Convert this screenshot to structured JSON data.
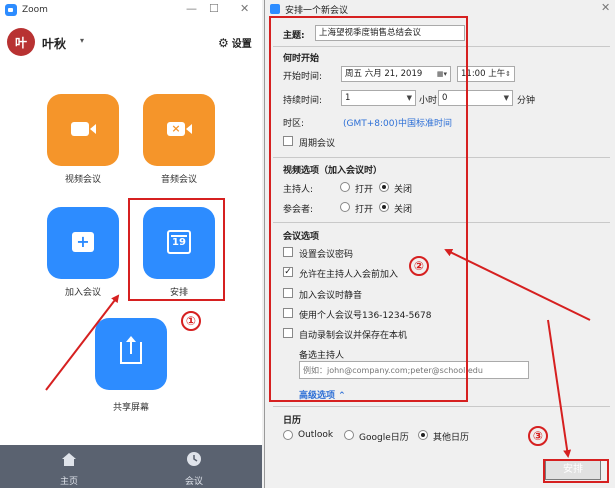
{
  "zoom_window": {
    "title": "Zoom",
    "min": "—",
    "max": "☐",
    "close": "✕",
    "avatar_initial": "叶",
    "username": "叶秋",
    "user_chevron": "▾",
    "settings_icon": "⚙",
    "settings_label": "设置",
    "tiles": {
      "video_meeting": "视频会议",
      "audio_meeting": "音频会议",
      "join_meeting": "加入会议",
      "schedule": "安排",
      "share_screen": "共享屏幕"
    },
    "schedule_icon_day": "19",
    "nav": {
      "home": "主页",
      "meetings": "会议"
    }
  },
  "dialog": {
    "title": "安排一个新会议",
    "close": "✕",
    "topic_label": "主题:",
    "topic_value": "上海望视季度销售总结会议",
    "when_heading": "何时开始",
    "start_label": "开始时间:",
    "start_date": "周五   六月  21, 2019",
    "start_time": "11:00 上午",
    "duration_label": "持续时间:",
    "duration_hours": "1",
    "hours_unit": "小时",
    "duration_minutes": "0",
    "minutes_unit": "分钟",
    "timezone_label": "时区:",
    "timezone_value": "(GMT+8:00)中国标准时间",
    "recurring_label": "周期会议",
    "video_heading": "视频选项（加入会议时）",
    "host_label": "主持人:",
    "participant_label": "参会者:",
    "on_label": "打开",
    "off_label": "关闭",
    "host_video_on": false,
    "participant_video_on": false,
    "meeting_heading": "会议选项",
    "options": [
      {
        "label": "设置会议密码",
        "checked": false
      },
      {
        "label": "允许在主持人入会前加入",
        "checked": true
      },
      {
        "label": "加入会议时静音",
        "checked": false
      },
      {
        "label": "使用个人会议号136-1234-5678",
        "checked": false
      },
      {
        "label": "自动录制会议并保存在本机",
        "checked": false
      }
    ],
    "alt_host_label": "备选主持人",
    "alt_host_placeholder": "例如：john@company.com;peter@school.edu",
    "advanced_label": "高级选项 ⌃",
    "calendar_heading": "日历",
    "calendar_outlook": "Outlook",
    "calendar_google": "Google日历",
    "calendar_other": "其他日历",
    "calendar_selected": "other",
    "schedule_button": "安排"
  },
  "annotations": {
    "step1": "①",
    "step2": "②",
    "step3": "③",
    "color": "#d62020"
  }
}
